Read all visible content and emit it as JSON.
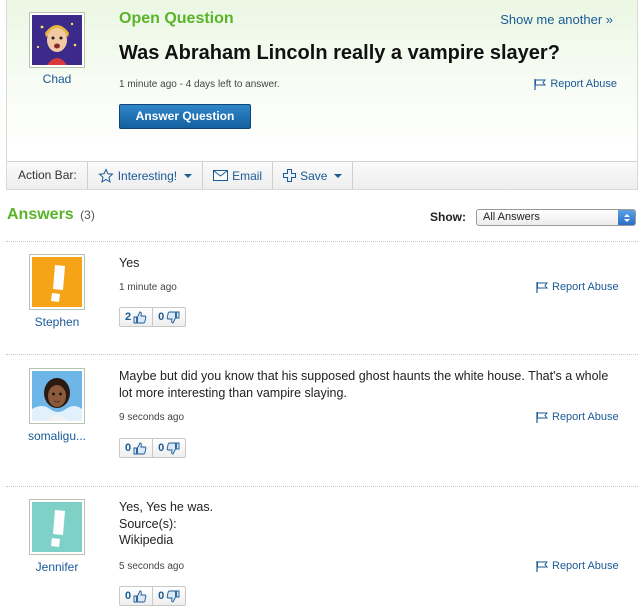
{
  "question": {
    "label": "Open Question",
    "show_another": "Show me another »",
    "title": "Was Abraham Lincoln really a vampire slayer?",
    "meta": "1 minute ago - 4 days left to answer.",
    "report": "Report Abuse",
    "answer_button": "Answer Question",
    "asker": {
      "name": "Chad",
      "avatar_icon": "cartoon-boy-avatar-icon"
    }
  },
  "action_bar": {
    "label": "Action Bar:",
    "interesting": "Interesting!",
    "email": "Email",
    "save": "Save"
  },
  "answers_header": {
    "title": "Answers",
    "count": "(3)",
    "show_label": "Show:",
    "show_value": "All Answers"
  },
  "answers": [
    {
      "name": "Stephen",
      "text": "Yes",
      "time": "1 minute ago",
      "thumbs_up": "2",
      "thumbs_down": "0",
      "report": "Report Abuse",
      "avatar_color": "#f5a317"
    },
    {
      "name": "somaligu...",
      "text": "Maybe but did you know that his supposed ghost haunts the white house. That's a whole lot more interesting than vampire slaying.",
      "time": "9 seconds ago",
      "thumbs_up": "0",
      "thumbs_down": "0",
      "report": "Report Abuse"
    },
    {
      "name": "Jennifer",
      "text": "Yes, Yes he was.",
      "source_label": "Source(s):",
      "source": "Wikipedia",
      "time": "5 seconds ago",
      "thumbs_up": "0",
      "thumbs_down": "0",
      "report": "Report Abuse",
      "avatar_color": "#7fd1c7"
    }
  ],
  "colors": {
    "accent_green": "#59b42a",
    "link_blue": "#1a5a96",
    "button_blue": "#15609f"
  }
}
